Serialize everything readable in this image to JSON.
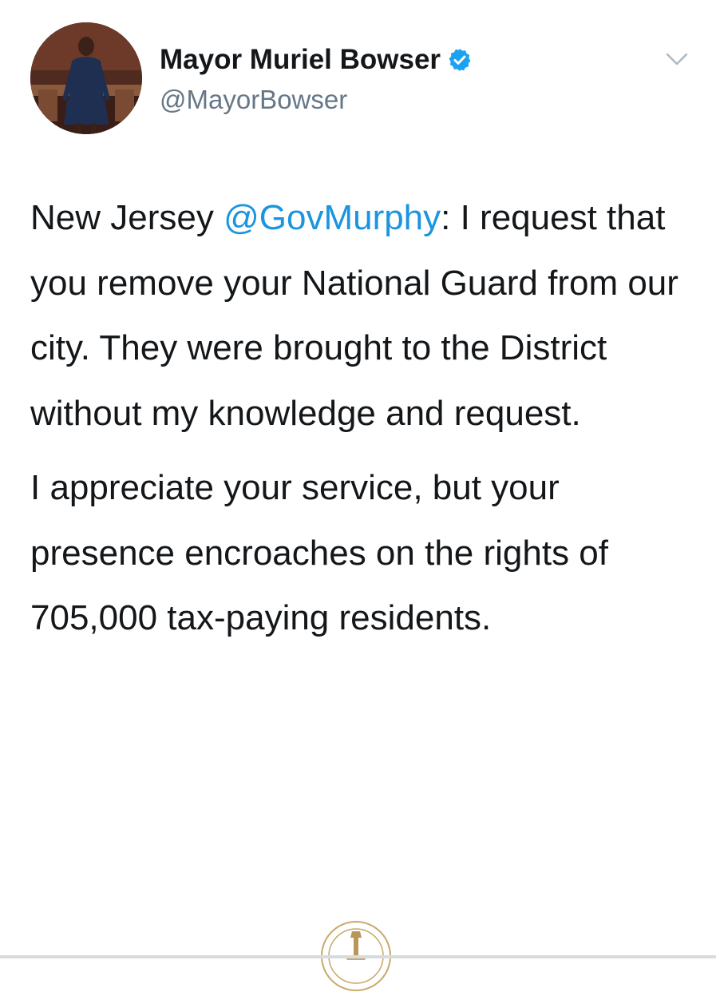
{
  "tweet": {
    "author": {
      "display_name": "Mayor Muriel Bowser",
      "handle": "@MayorBowser",
      "verified": true,
      "verified_icon": "verified-badge-icon",
      "avatar": "profile-photo"
    },
    "menu_icon": "chevron-down-icon",
    "paragraph_1": {
      "prefix": "New Jersey ",
      "mention": "@GovMurphy",
      "rest": ": I request that you remove your National Guard from our city. They were brought to the District without my knowledge and request."
    },
    "paragraph_2": "I appreciate your service, but your presence encroaches on the rights of 705,000 tax-paying residents.",
    "attached_image": "dc-seal-image"
  },
  "colors": {
    "text": "#14171a",
    "handle": "#657786",
    "link": "#1b95e0",
    "verified": "#1da1f2"
  }
}
